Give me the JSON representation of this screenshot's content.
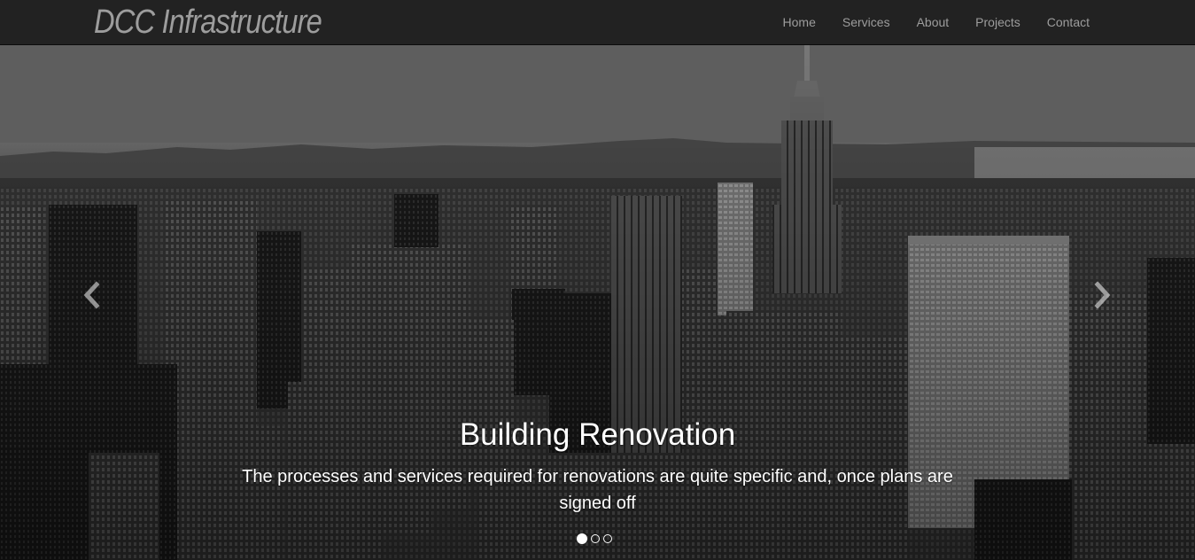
{
  "navbar": {
    "brand": "DCC Infrastructure",
    "links": [
      {
        "label": "Home"
      },
      {
        "label": "Services"
      },
      {
        "label": "About"
      },
      {
        "label": "Projects"
      },
      {
        "label": "Contact"
      }
    ]
  },
  "carousel": {
    "prev_icon": "chevron-left-icon",
    "next_icon": "chevron-right-icon",
    "slide": {
      "title": "Building Renovation",
      "text": "The processes and services required for renovations are quite specific and, once plans are signed off"
    },
    "indicator_count": 3,
    "active_indicator": 0
  },
  "colors": {
    "navbar_bg": "#222222",
    "nav_text": "#9d9d9d",
    "caption_text": "#ffffff"
  }
}
